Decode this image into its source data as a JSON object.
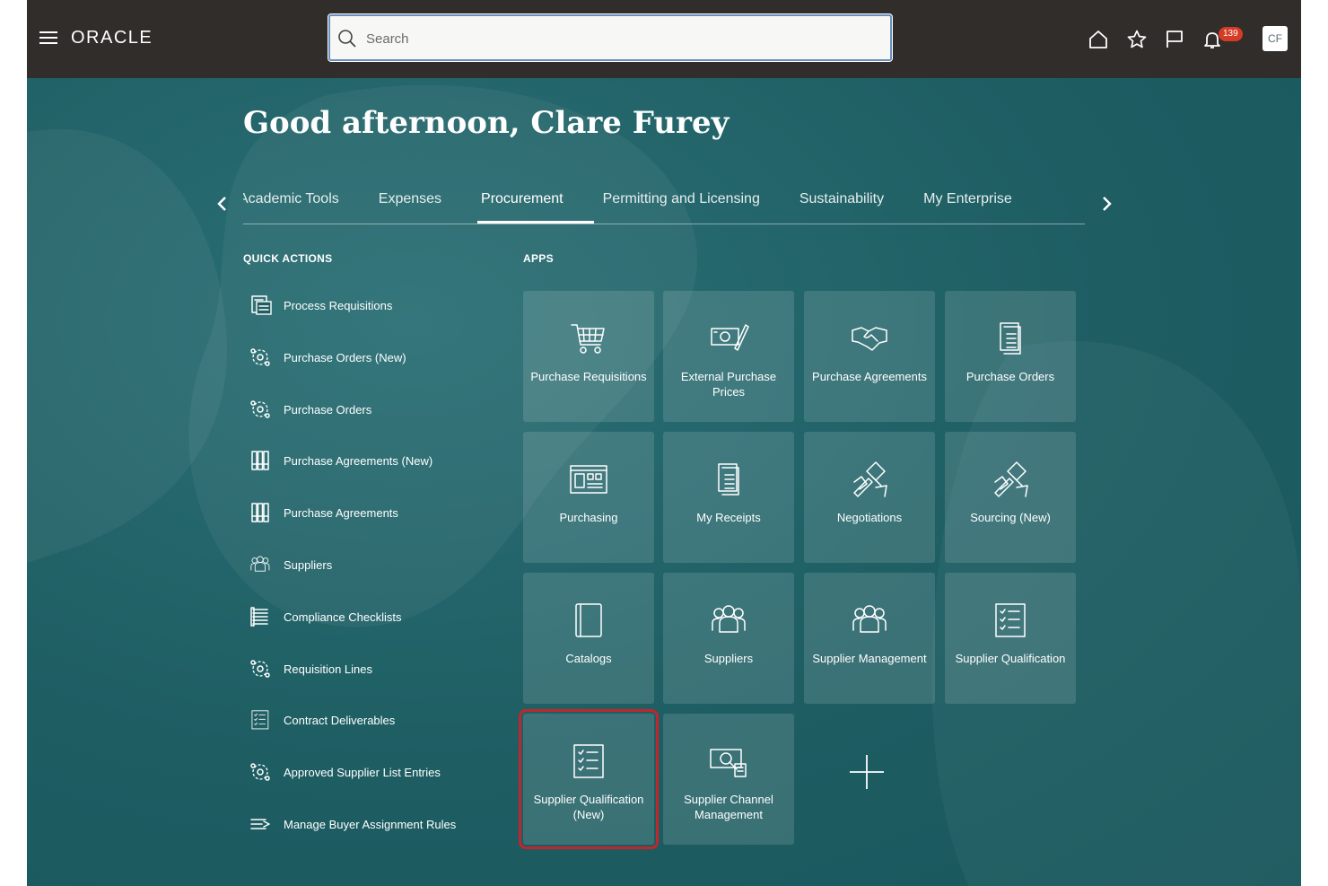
{
  "topbar": {
    "logo": "ORACLE",
    "search_placeholder": "Search",
    "notification_count": "139",
    "user_initials": "CF",
    "icons": [
      "menu-icon",
      "home-icon",
      "star-icon",
      "flag-icon",
      "bell-icon"
    ]
  },
  "greeting": "Good afternoon, Clare Furey",
  "tabs": [
    {
      "label": "Academic Tools",
      "active": false
    },
    {
      "label": "Expenses",
      "active": false
    },
    {
      "label": "Procurement",
      "active": true
    },
    {
      "label": "Permitting and Licensing",
      "active": false
    },
    {
      "label": "Sustainability",
      "active": false
    },
    {
      "label": "My Enterprise",
      "active": false
    }
  ],
  "quick_actions": {
    "title": "QUICK ACTIONS",
    "items": [
      {
        "label": "Process Requisitions",
        "icon": "requisition-icon"
      },
      {
        "label": "Purchase Orders (New)",
        "icon": "gear-cycle-icon"
      },
      {
        "label": "Purchase Orders",
        "icon": "gear-cycle-icon"
      },
      {
        "label": "Purchase Agreements (New)",
        "icon": "binders-icon"
      },
      {
        "label": "Purchase Agreements",
        "icon": "binders-icon"
      },
      {
        "label": "Suppliers",
        "icon": "people-icon"
      },
      {
        "label": "Compliance Checklists",
        "icon": "checklist-stack-icon"
      },
      {
        "label": "Requisition Lines",
        "icon": "gear-cycle-icon"
      },
      {
        "label": "Contract Deliverables",
        "icon": "checklist-icon"
      },
      {
        "label": "Approved Supplier List Entries",
        "icon": "gear-cycle-icon"
      },
      {
        "label": "Manage Buyer Assignment Rules",
        "icon": "rules-icon"
      }
    ]
  },
  "apps": {
    "title": "APPS",
    "tiles": [
      {
        "label": "Purchase Requisitions",
        "icon": "cart-icon"
      },
      {
        "label": "External Purchase Prices",
        "icon": "money-pen-icon"
      },
      {
        "label": "Purchase Agreements",
        "icon": "handshake-icon"
      },
      {
        "label": "Purchase Orders",
        "icon": "document-icon"
      },
      {
        "label": "Purchasing",
        "icon": "dashboard-icon"
      },
      {
        "label": "My Receipts",
        "icon": "document-icon"
      },
      {
        "label": "Negotiations",
        "icon": "gavel-icon"
      },
      {
        "label": "Sourcing (New)",
        "icon": "gavel-icon"
      },
      {
        "label": "Catalogs",
        "icon": "book-icon"
      },
      {
        "label": "Suppliers",
        "icon": "people-icon"
      },
      {
        "label": "Supplier Management",
        "icon": "people-icon"
      },
      {
        "label": "Supplier Qualification",
        "icon": "checklist-icon"
      },
      {
        "label": "Supplier Qualification (New)",
        "icon": "checklist-icon",
        "selected": true
      },
      {
        "label": "Supplier Channel Management",
        "icon": "money-search-icon"
      }
    ]
  },
  "colors": {
    "topbar": "#312d2a",
    "hero": "#1e5e63",
    "badge": "#d63b25",
    "highlight": "#c0262d"
  }
}
